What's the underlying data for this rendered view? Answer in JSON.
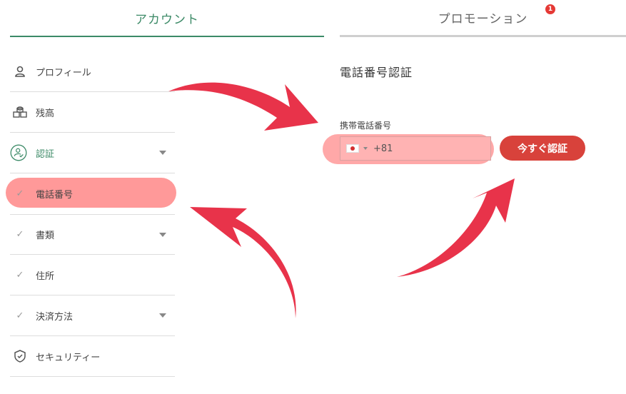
{
  "tabs": {
    "account": "アカウント",
    "promotion": "プロモーション",
    "promotion_badge": "1"
  },
  "sidebar": {
    "items": [
      {
        "label": "プロフィール",
        "icon": "user-icon"
      },
      {
        "label": "残高",
        "icon": "coins-icon"
      },
      {
        "label": "認証",
        "icon": "user-check-icon"
      },
      {
        "label": "電話番号",
        "icon": "check-icon"
      },
      {
        "label": "書類",
        "icon": "check-icon"
      },
      {
        "label": "住所",
        "icon": "check-icon"
      },
      {
        "label": "決済方法",
        "icon": "check-icon"
      },
      {
        "label": "セキュリティー",
        "icon": "shield-icon"
      }
    ]
  },
  "content": {
    "title": "電話番号認証",
    "phone_label": "携帯電話番号",
    "phone_prefix": "+81",
    "verify_button": "今すぐ認証"
  },
  "colors": {
    "accent": "#3c8a67",
    "highlight": "#ff9999",
    "button": "#d8423b",
    "arrow": "#e8334a"
  }
}
